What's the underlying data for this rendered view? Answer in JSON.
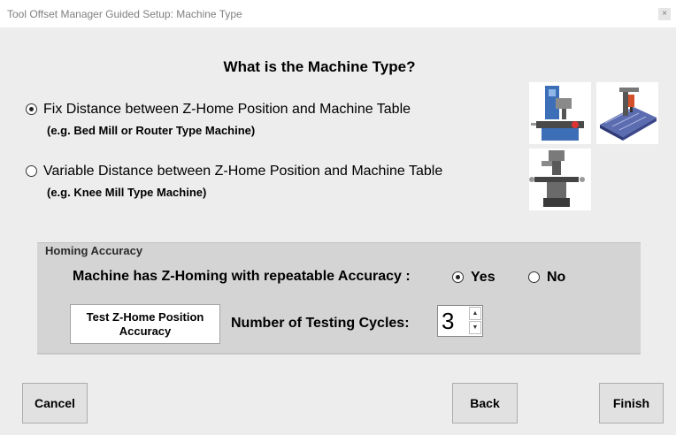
{
  "window": {
    "title": "Tool Offset Manager Guided Setup: Machine Type",
    "close_glyph": "×"
  },
  "heading": "What is the Machine Type?",
  "machine_types": [
    {
      "label": "Fix Distance between Z-Home Position and Machine Table",
      "example": "(e.g. Bed Mill or Router Type Machine)",
      "selected": true,
      "images": [
        "bed-mill-image",
        "router-image"
      ]
    },
    {
      "label": "Variable Distance between Z-Home Position and Machine Table",
      "example": "(e.g. Knee Mill Type Machine)",
      "selected": false,
      "images": [
        "knee-mill-image"
      ]
    }
  ],
  "homing": {
    "group_title": "Homing Accuracy",
    "question": "Machine has Z-Homing with repeatable Accuracy :",
    "yes_label": "Yes",
    "no_label": "No",
    "selected": "Yes",
    "test_button_line1": "Test Z-Home Position",
    "test_button_line2": "Accuracy",
    "cycles_label": "Number of Testing Cycles:",
    "cycles_value": "3"
  },
  "buttons": {
    "cancel": "Cancel",
    "back": "Back",
    "finish": "Finish"
  }
}
